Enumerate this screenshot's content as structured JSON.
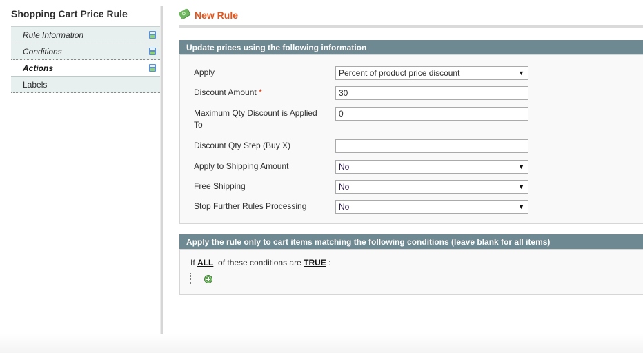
{
  "sidebar": {
    "title": "Shopping Cart Price Rule",
    "tabs": [
      {
        "label": "Rule Information",
        "icon": "save-icon",
        "active": false
      },
      {
        "label": "Conditions",
        "icon": "save-icon",
        "active": false
      },
      {
        "label": "Actions",
        "icon": "save-icon",
        "active": true
      },
      {
        "label": "Labels",
        "icon": null,
        "active": false
      }
    ]
  },
  "header": {
    "icon": "money-rule-icon",
    "title": "New Rule"
  },
  "actions_section": {
    "heading": "Update prices using the following information",
    "fields": {
      "apply": {
        "label": "Apply",
        "value": "Percent of product price discount"
      },
      "discount_amount": {
        "label": "Discount Amount",
        "required_mark": "*",
        "value": "30"
      },
      "max_qty": {
        "label": "Maximum Qty Discount is Applied To",
        "value": "0"
      },
      "qty_step": {
        "label": "Discount Qty Step (Buy X)",
        "value": ""
      },
      "apply_to_shipping": {
        "label": "Apply to Shipping Amount",
        "value": "No"
      },
      "free_shipping": {
        "label": "Free Shipping",
        "value": "No"
      },
      "stop_rules": {
        "label": "Stop Further Rules Processing",
        "value": "No"
      }
    },
    "dropdown_arrow": "▼"
  },
  "conditions_section": {
    "heading": "Apply the rule only to cart items matching the following conditions (leave blank for all items)",
    "prefix": "If",
    "aggregator": "ALL",
    "middle": "of these conditions are",
    "value": "TRUE",
    "suffix": ":",
    "add_icon": "add-condition-icon"
  }
}
